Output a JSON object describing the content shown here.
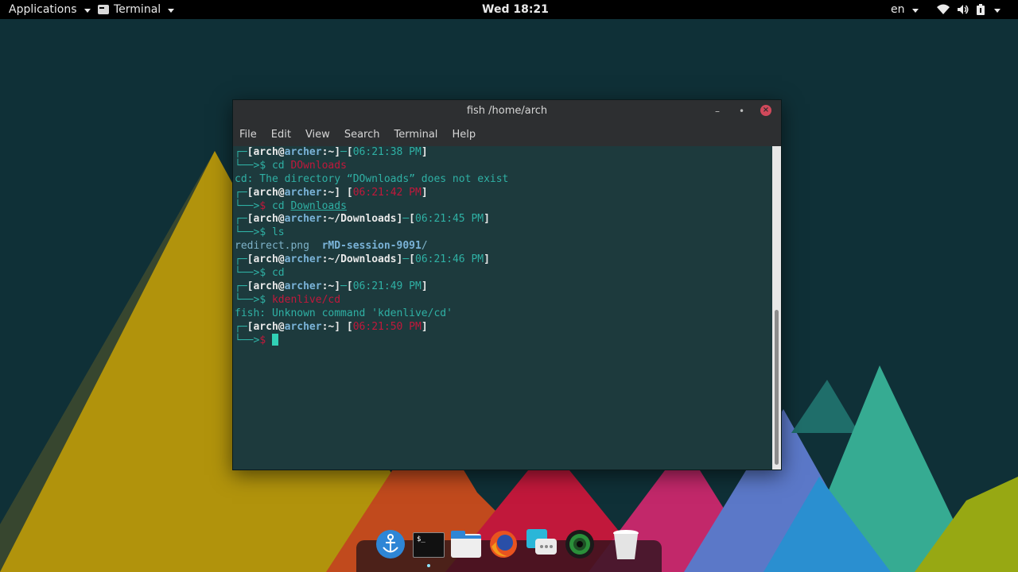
{
  "topbar": {
    "applications_label": "Applications",
    "terminal_label": "Terminal",
    "clock": "Wed 18:21",
    "language": "en"
  },
  "window": {
    "title": "fish  /home/arch",
    "minimize_glyph": "–",
    "maximize_glyph": "•",
    "close_glyph": "×"
  },
  "menubar": {
    "items": [
      "File",
      "Edit",
      "View",
      "Search",
      "Terminal",
      "Help"
    ]
  },
  "terminal": {
    "user": "arch",
    "at": "@",
    "host": "archer",
    "lines": [
      {
        "kind": "prompt",
        "path": "~",
        "time": "06:21:38 PM",
        "time_color": "green",
        "sep": "─"
      },
      {
        "kind": "cmd",
        "parts": [
          {
            "t": "cd ",
            "c": "cmd"
          },
          {
            "t": "DOwnloads",
            "c": "bad"
          }
        ],
        "arrow_color": "green"
      },
      {
        "kind": "out",
        "text": "cd: The directory “DOwnloads” does not exist",
        "c": "g"
      },
      {
        "kind": "prompt",
        "path": "~",
        "time": "06:21:42 PM",
        "time_color": "red",
        "sep": " "
      },
      {
        "kind": "cmd",
        "parts": [
          {
            "t": "cd ",
            "c": "cmd"
          },
          {
            "t": "Downloads",
            "c": "ok"
          }
        ],
        "arrow_color": "red"
      },
      {
        "kind": "prompt",
        "path": "~/Downloads",
        "time": "06:21:45 PM",
        "time_color": "green",
        "sep": "─"
      },
      {
        "kind": "cmd",
        "parts": [
          {
            "t": "ls",
            "c": "cmd"
          }
        ],
        "arrow_color": "green"
      },
      {
        "kind": "ls",
        "parts": [
          {
            "t": "redirect.png",
            "c": "file"
          },
          {
            "t": "  ",
            "c": "g"
          },
          {
            "t": "rMD-session-9091",
            "c": "dir"
          },
          {
            "t": "/",
            "c": "file"
          }
        ]
      },
      {
        "kind": "prompt",
        "path": "~/Downloads",
        "time": "06:21:46 PM",
        "time_color": "green",
        "sep": "─"
      },
      {
        "kind": "cmd",
        "parts": [
          {
            "t": "cd",
            "c": "cmd"
          }
        ],
        "arrow_color": "green"
      },
      {
        "kind": "prompt",
        "path": "~",
        "time": "06:21:49 PM",
        "time_color": "green",
        "sep": "─"
      },
      {
        "kind": "cmd",
        "parts": [
          {
            "t": "kdenlive/cd",
            "c": "bad"
          }
        ],
        "arrow_color": "green"
      },
      {
        "kind": "out",
        "text": "fish: Unknown command 'kdenlive/cd'",
        "c": "g"
      },
      {
        "kind": "prompt",
        "path": "~",
        "time": "06:21:50 PM",
        "time_color": "red",
        "sep": " "
      },
      {
        "kind": "cursor",
        "arrow_color": "red"
      }
    ]
  },
  "dock": {
    "items": [
      {
        "name": "anchor-app-icon"
      },
      {
        "name": "terminal-app-icon",
        "label": "$_"
      },
      {
        "name": "files-app-icon"
      },
      {
        "name": "firefox-app-icon"
      },
      {
        "name": "chat-app-icon"
      },
      {
        "name": "camera-app-icon"
      },
      {
        "name": "trash-app-icon"
      }
    ]
  },
  "colors": {
    "accent_teal": "#2fb0a4",
    "error_red": "#c1183b",
    "window_bg": "#1d3a3d",
    "chrome": "#2d2f31"
  }
}
